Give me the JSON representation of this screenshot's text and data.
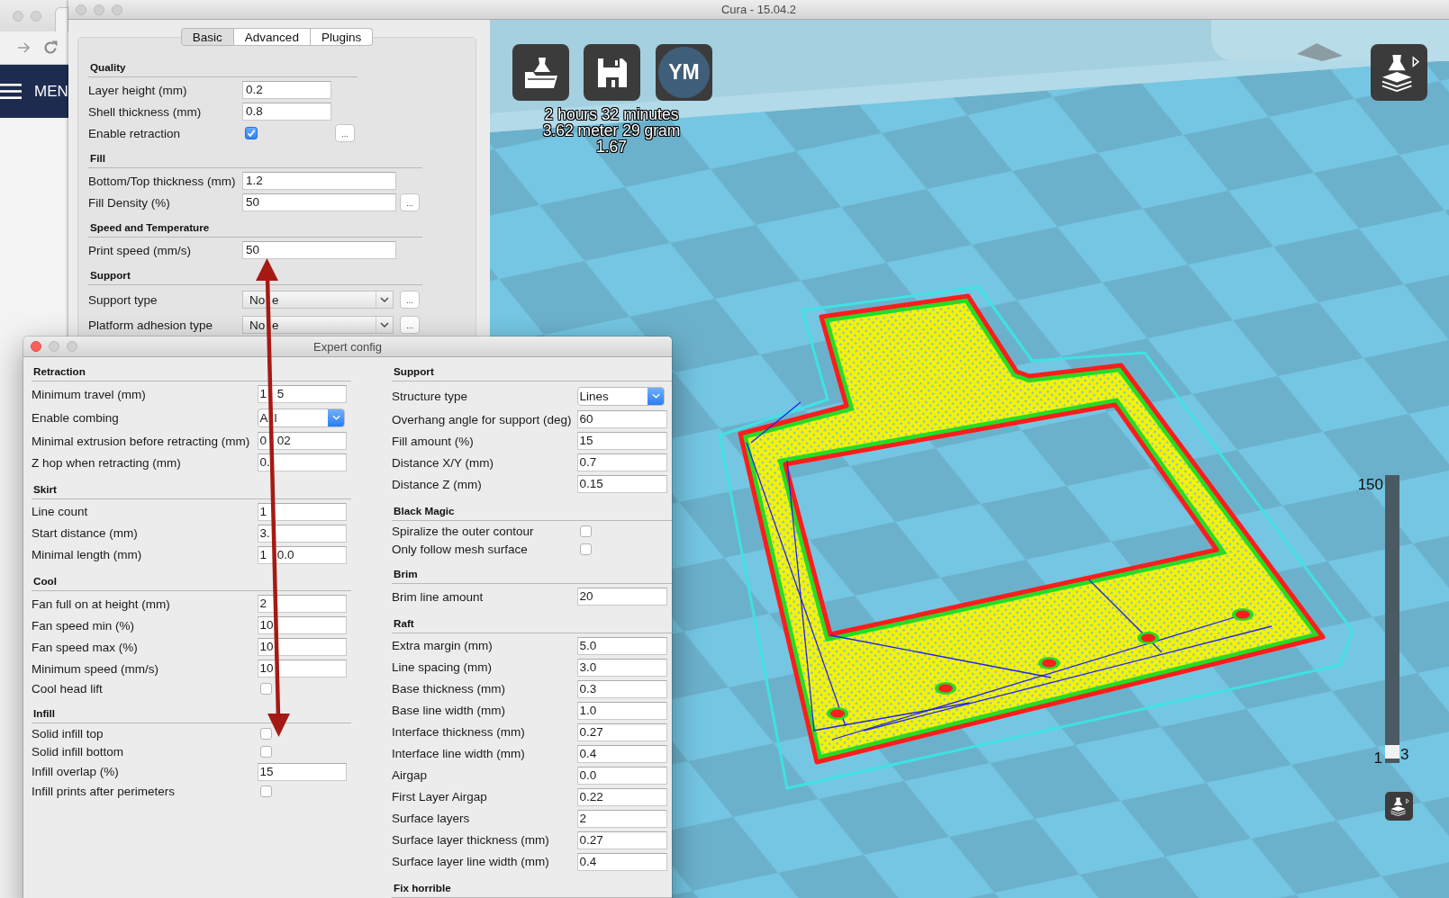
{
  "browser_window": {
    "menu_label": "MEN"
  },
  "window": {
    "title": "Cura - 15.04.2"
  },
  "settings_panel": {
    "tabs": [
      {
        "label": "Basic",
        "selected": true
      },
      {
        "label": "Advanced",
        "selected": false
      },
      {
        "label": "Plugins",
        "selected": false
      }
    ],
    "sections": [
      {
        "title": "Quality",
        "rows": [
          {
            "kind": "text",
            "label": "Layer height (mm)",
            "value": "0.2"
          },
          {
            "kind": "text",
            "label": "Shell thickness (mm)",
            "value": "0.8"
          },
          {
            "kind": "checkbox",
            "label": "Enable retraction",
            "checked": true,
            "more": "..."
          }
        ]
      },
      {
        "title": "Fill",
        "rows": [
          {
            "kind": "text",
            "label": "Bottom/Top thickness (mm)",
            "value": "1.2"
          },
          {
            "kind": "text",
            "label": "Fill Density (%)",
            "value": "50",
            "more": "..."
          }
        ]
      },
      {
        "title": "Speed and Temperature",
        "rows": [
          {
            "kind": "text",
            "label": "Print speed (mm/s)",
            "value": "50"
          }
        ]
      },
      {
        "title": "Support",
        "rows": [
          {
            "kind": "select",
            "label": "Support type",
            "value": "No e",
            "more": "..."
          },
          {
            "kind": "select",
            "label": "Platform adhesion type",
            "value": "No e",
            "more": "..."
          }
        ]
      }
    ]
  },
  "viewport": {
    "logo_button": {
      "label": "YM"
    },
    "print_info": [
      "2 hours 32 minutes",
      "3.62 meter 29 gram",
      "1.67"
    ],
    "layer_slider": {
      "max_label": "150",
      "min_label": "1",
      "current_label": "3",
      "level": 0.01
    }
  },
  "expert_config": {
    "title": "Expert config",
    "columns": [
      {
        "sections": [
          {
            "title": "Retraction",
            "rows": [
              {
                "kind": "text",
                "label": "Minimum travel (mm)",
                "value": "1 5"
              },
              {
                "kind": "select",
                "label": "Enable combing",
                "value": "A l"
              },
              {
                "kind": "text",
                "label": "Minimal extrusion before retracting (mm)",
                "value": "0 02"
              },
              {
                "kind": "text",
                "label": "Z hop when retracting (mm)",
                "value": "0."
              }
            ]
          },
          {
            "title": "Skirt",
            "rows": [
              {
                "kind": "text",
                "label": "Line count",
                "value": "1"
              },
              {
                "kind": "text",
                "label": "Start distance (mm)",
                "value": "3."
              },
              {
                "kind": "text",
                "label": "Minimal length (mm)",
                "value": "1 0.0"
              }
            ]
          },
          {
            "title": "Cool",
            "rows": [
              {
                "kind": "text",
                "label": "Fan full on at height (mm)",
                "value": "2"
              },
              {
                "kind": "text",
                "label": "Fan speed min (%)",
                "value": "10"
              },
              {
                "kind": "text",
                "label": "Fan speed max (%)",
                "value": "10"
              },
              {
                "kind": "text",
                "label": "Minimum speed (mm/s)",
                "value": "10"
              },
              {
                "kind": "checkbox",
                "label": "Cool head lift",
                "checked": false
              }
            ]
          },
          {
            "title": "Infill",
            "rows": [
              {
                "kind": "checkbox",
                "label": "Solid infill top",
                "checked": false
              },
              {
                "kind": "checkbox",
                "label": "Solid infill bottom",
                "checked": false
              },
              {
                "kind": "text",
                "label": "Infill overlap (%)",
                "value": "15"
              },
              {
                "kind": "checkbox",
                "label": "Infill prints after perimeters",
                "checked": false
              }
            ]
          }
        ]
      },
      {
        "sections": [
          {
            "title": "Support",
            "rows": [
              {
                "kind": "select",
                "label": "Structure type",
                "value": "Lines"
              },
              {
                "kind": "text",
                "label": "Overhang angle for support (deg)",
                "value": "60"
              },
              {
                "kind": "text",
                "label": "Fill amount (%)",
                "value": "15"
              },
              {
                "kind": "text",
                "label": "Distance X/Y (mm)",
                "value": "0.7"
              },
              {
                "kind": "text",
                "label": "Distance Z (mm)",
                "value": "0.15"
              }
            ]
          },
          {
            "title": "Black Magic",
            "rows": [
              {
                "kind": "checkbox",
                "label": "Spiralize the outer contour",
                "checked": false
              },
              {
                "kind": "checkbox",
                "label": "Only follow mesh surface",
                "checked": false
              }
            ]
          },
          {
            "title": "Brim",
            "rows": [
              {
                "kind": "text",
                "label": "Brim line amount",
                "value": "20"
              }
            ]
          },
          {
            "title": "Raft",
            "rows": [
              {
                "kind": "text",
                "label": "Extra margin (mm)",
                "value": "5.0"
              },
              {
                "kind": "text",
                "label": "Line spacing (mm)",
                "value": "3.0"
              },
              {
                "kind": "text",
                "label": "Base thickness (mm)",
                "value": "0.3"
              },
              {
                "kind": "text",
                "label": "Base line width (mm)",
                "value": "1.0"
              },
              {
                "kind": "text",
                "label": "Interface thickness (mm)",
                "value": "0.27"
              },
              {
                "kind": "text",
                "label": "Interface line width (mm)",
                "value": "0.4"
              },
              {
                "kind": "text",
                "label": "Airgap",
                "value": "0.0"
              },
              {
                "kind": "text",
                "label": "First Layer Airgap",
                "value": "0.22"
              },
              {
                "kind": "text",
                "label": "Surface layers",
                "value": "2"
              },
              {
                "kind": "text",
                "label": "Surface layer thickness (mm)",
                "value": "0.27"
              },
              {
                "kind": "text",
                "label": "Surface layer line width (mm)",
                "value": "0.4"
              }
            ]
          },
          {
            "title": "Fix horrible"
          }
        ]
      }
    ]
  }
}
